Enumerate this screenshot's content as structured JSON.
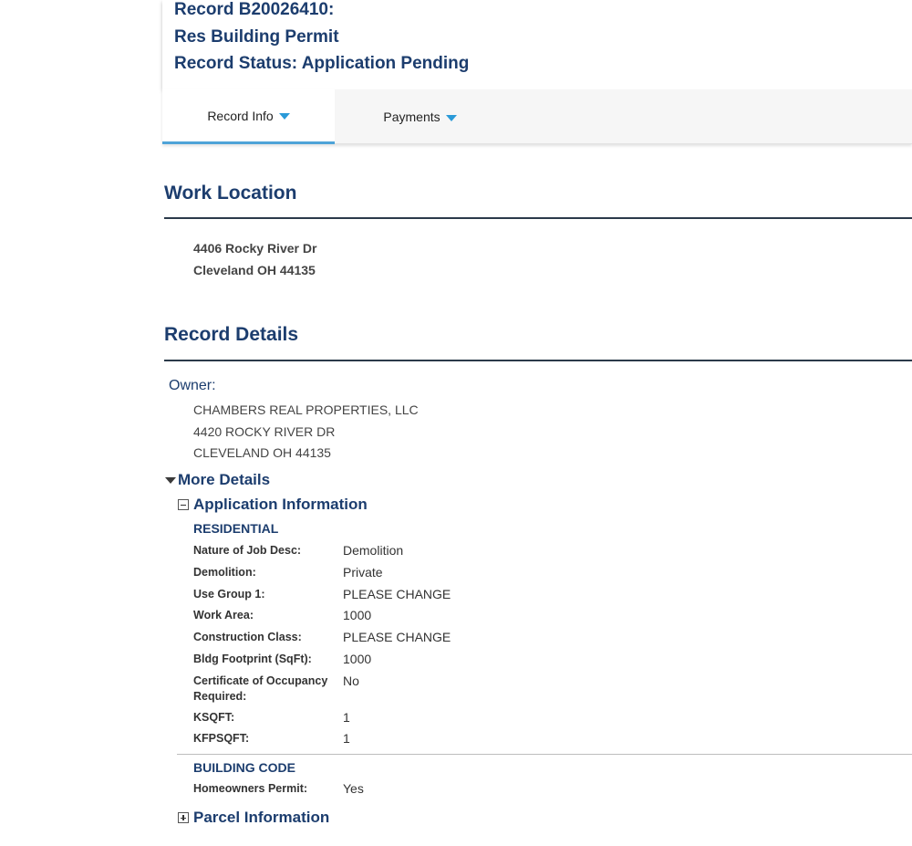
{
  "header": {
    "record_line": "Record B20026410:",
    "type_line": "Res Building Permit",
    "status_line": "Record Status: Application Pending"
  },
  "tabs": [
    {
      "label": "Record Info",
      "active": true
    },
    {
      "label": "Payments",
      "active": false
    }
  ],
  "work_location": {
    "title": "Work Location",
    "address_line1": "4406 Rocky River Dr",
    "address_line2": "Cleveland OH 44135"
  },
  "record_details": {
    "title": "Record Details",
    "owner_label": "Owner:",
    "owner_name": "CHAMBERS REAL PROPERTIES, LLC",
    "owner_street": "4420 ROCKY RIVER DR",
    "owner_city": "CLEVELAND OH 44135"
  },
  "more_details": {
    "label": "More Details",
    "application_info": {
      "label": "Application Information",
      "residential": {
        "heading": "RESIDENTIAL",
        "rows": [
          {
            "key": "Nature of Job Desc:",
            "value": "Demolition"
          },
          {
            "key": "Demolition:",
            "value": "Private"
          },
          {
            "key": "Use Group 1:",
            "value": "PLEASE CHANGE"
          },
          {
            "key": "Work Area:",
            "value": "1000"
          },
          {
            "key": "Construction Class:",
            "value": "PLEASE CHANGE"
          },
          {
            "key": "Bldg Footprint (SqFt):",
            "value": "1000"
          },
          {
            "key": "Certificate of Occupancy Required:",
            "value": "No"
          },
          {
            "key": "KSQFT:",
            "value": "1"
          },
          {
            "key": "KFPSQFT:",
            "value": "1"
          }
        ]
      },
      "building_code": {
        "heading": "BUILDING CODE",
        "rows": [
          {
            "key": "Homeowners Permit:",
            "value": "Yes"
          }
        ]
      }
    },
    "parcel_info": {
      "label": "Parcel Information"
    }
  },
  "colors": {
    "heading_blue": "#1c3d6e",
    "tab_accent": "#4ea3d8",
    "caret_blue": "#2a9ad8"
  },
  "icons": {
    "tab_caret": "caret-down-icon",
    "more_details_toggle": "triangle-down-icon",
    "collapse": "minus-box-icon",
    "expand": "plus-box-icon"
  }
}
